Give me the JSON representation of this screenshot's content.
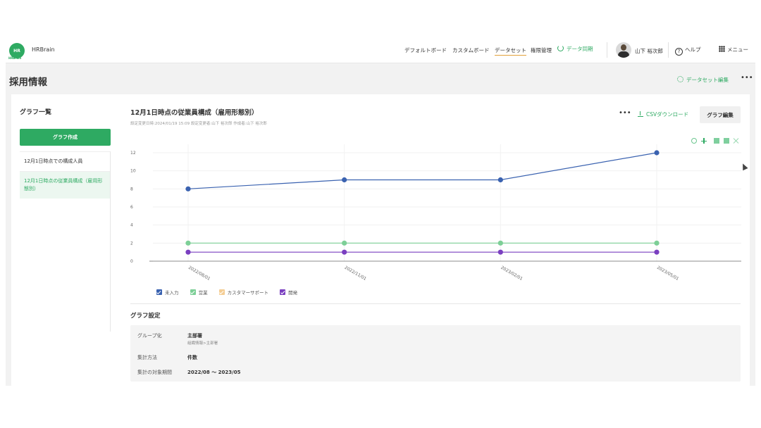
{
  "header": {
    "logo_text": "HR",
    "logo_sub": "HRBrain",
    "brand": "HRBrain",
    "nav": [
      "デフォルトボード",
      "カスタムボード",
      "データセット",
      "権限管理"
    ],
    "sync_label": "データ同期",
    "user_name": "山下 裕次郎",
    "help_label": "ヘルプ",
    "menu_label": "メニュー"
  },
  "page": {
    "title": "採用情報",
    "dataset_edit": "データセット編集",
    "more": "•••"
  },
  "sidebar": {
    "title": "グラフ一覧",
    "create_button": "グラフ作成",
    "items": [
      "12月1日時点での構成人員",
      "12月1日時点の従業員構成（雇用形態別）"
    ]
  },
  "chart_panel": {
    "title": "12月1日時点の従業員構成（雇用形態別）",
    "meta": "設定変更日時:2024/01/19 15:09  設定変更者:山下 裕次郎  作成者:山下 裕次郎",
    "more": "•••",
    "csv_download": "CSVダウンロード",
    "edit_button": "グラフ編集"
  },
  "chart_data": {
    "type": "line",
    "x": [
      "2022/08/01",
      "2022/11/01",
      "2023/02/01",
      "2023/05/01"
    ],
    "ylim": [
      0,
      12
    ],
    "yticks": [
      0,
      2,
      4,
      6,
      8,
      10,
      12
    ],
    "grid": true,
    "legend_position": "bottom-left",
    "series": [
      {
        "name": "未入力",
        "values": [
          8,
          9,
          9,
          12
        ],
        "color": "#3a62b0"
      },
      {
        "name": "営業",
        "values": [
          2,
          2,
          2,
          2
        ],
        "color": "#7dcf97"
      },
      {
        "name": "カスタマーサポート",
        "values": [],
        "color": "#f4cd94"
      },
      {
        "name": "開発",
        "values": [
          1,
          1,
          1,
          1
        ],
        "color": "#7a3fc0"
      }
    ]
  },
  "graph_settings": {
    "title": "グラフ設定",
    "rows": [
      {
        "label": "グループ化",
        "value": "主部署",
        "sub": "組織情報>主部署"
      },
      {
        "label": "集計方法",
        "value": "件数"
      },
      {
        "label": "集計の対象期間",
        "value": "2022/08 〜 2023/05"
      }
    ]
  }
}
